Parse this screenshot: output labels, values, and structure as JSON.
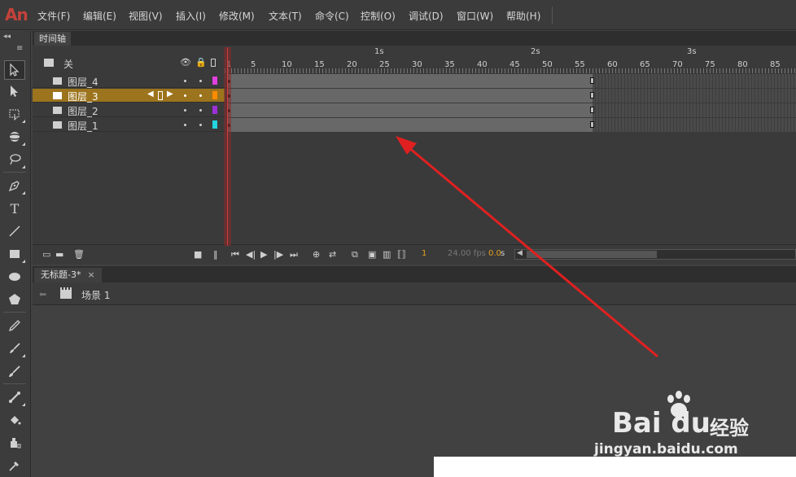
{
  "app": {
    "logo": "An"
  },
  "menu": [
    {
      "label": "文件(F)"
    },
    {
      "label": "编辑(E)"
    },
    {
      "label": "视图(V)"
    },
    {
      "label": "插入(I)"
    },
    {
      "label": "修改(M)"
    },
    {
      "label": "文本(T)"
    },
    {
      "label": "命令(C)"
    },
    {
      "label": "控制(O)"
    },
    {
      "label": "调试(D)"
    },
    {
      "label": "窗口(W)"
    },
    {
      "label": "帮助(H)"
    }
  ],
  "tools": [
    {
      "icon": "selection-tool-icon"
    },
    {
      "icon": "subselection-tool-icon"
    },
    {
      "icon": "free-transform-tool-icon"
    },
    {
      "icon": "3d-rotation-tool-icon"
    },
    {
      "icon": "lasso-tool-icon"
    },
    {
      "icon": "pen-tool-icon"
    },
    {
      "icon": "text-tool-icon",
      "glyph": "T"
    },
    {
      "icon": "line-tool-icon"
    },
    {
      "icon": "rectangle-tool-icon"
    },
    {
      "icon": "oval-tool-icon"
    },
    {
      "icon": "polystar-tool-icon"
    },
    {
      "icon": "pencil-tool-icon"
    },
    {
      "icon": "paint-brush-tool-icon"
    },
    {
      "icon": "brush-tool-icon"
    },
    {
      "icon": "bone-tool-icon"
    },
    {
      "icon": "paint-bucket-tool-icon"
    },
    {
      "icon": "ink-bottle-tool-icon"
    },
    {
      "icon": "eyedropper-tool-icon"
    }
  ],
  "timeline": {
    "tab_label": "时间轴",
    "header_label": "关",
    "seconds": [
      "1s",
      "2s",
      "3s"
    ],
    "frame_numbers": [
      "1",
      "5",
      "10",
      "15",
      "20",
      "25",
      "30",
      "35",
      "40",
      "45",
      "50",
      "55",
      "60",
      "65",
      "70",
      "75",
      "80",
      "85"
    ],
    "layers": [
      {
        "name": "图层_4",
        "color": "#e040e0",
        "selected": false
      },
      {
        "name": "图层_3",
        "color": "#ff8c00",
        "selected": true
      },
      {
        "name": "图层_2",
        "color": "#9b30d9",
        "selected": false
      },
      {
        "name": "图层_1",
        "color": "#22d3e0",
        "selected": false
      }
    ],
    "footer": {
      "current_frame": "1",
      "fps": "24.00 fps",
      "time": "0.0",
      "time_unit": "s"
    }
  },
  "document": {
    "tab_label": "无标题-3*",
    "close_glyph": "×",
    "scene_label": "场景 1"
  },
  "watermark": {
    "main": "Bai du",
    "sub": "经验",
    "url": "jingyan.baidu.com"
  }
}
